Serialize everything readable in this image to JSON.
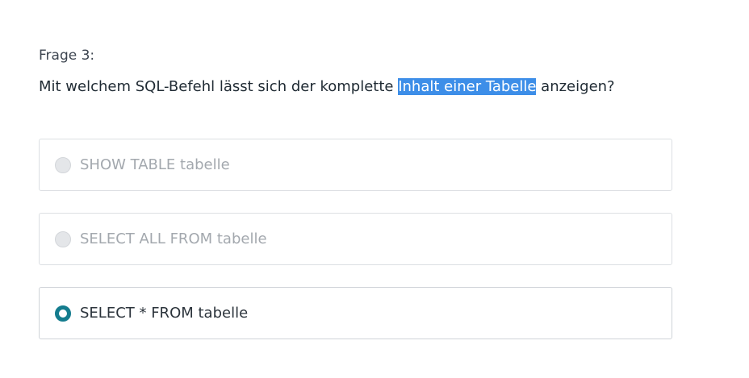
{
  "question": {
    "number_label": "Frage 3:",
    "text_before": "Mit welchem SQL-Befehl lässt sich der komplette ",
    "text_highlighted": "Inhalt einer Tabelle",
    "text_after": " anzeigen?"
  },
  "options": [
    {
      "label": "SHOW TABLE tabelle",
      "selected": false
    },
    {
      "label": "SELECT ALL FROM tabelle",
      "selected": false
    },
    {
      "label": "SELECT * FROM tabelle",
      "selected": true
    }
  ],
  "colors": {
    "accent": "#147c8e",
    "selection_highlight": "#3d8ee8"
  }
}
